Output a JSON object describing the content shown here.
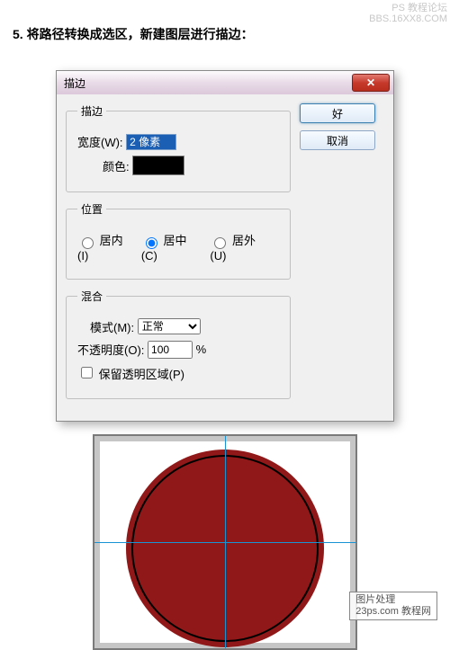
{
  "watermark_top": {
    "line1": "PS 教程论坛",
    "line2": "BBS.16XX8.COM"
  },
  "step": {
    "number": "5.",
    "text": "将路径转换成选区，新建图层进行描边："
  },
  "dialog": {
    "title": "描边",
    "stroke": {
      "legend": "描边",
      "width_label": "宽度(W):",
      "width_value": "2 像素",
      "color_label": "颜色:",
      "color_value": "#000000"
    },
    "location": {
      "legend": "位置",
      "inside": "居内(I)",
      "center": "居中(C)",
      "outside": "居外(U)",
      "selected": "center"
    },
    "blending": {
      "legend": "混合",
      "mode_label": "模式(M):",
      "mode_value": "正常",
      "opacity_label": "不透明度(O):",
      "opacity_value": "100",
      "opacity_unit": "%",
      "preserve_label": "保留透明区域(P)"
    },
    "buttons": {
      "ok": "好",
      "cancel": "取消"
    }
  },
  "watermark_box": {
    "line1": "图片处理",
    "line2": "23ps.com 教程网"
  }
}
